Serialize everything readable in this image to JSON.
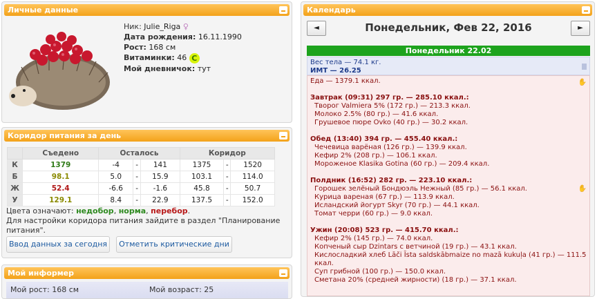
{
  "personal": {
    "title": "Личные данные",
    "nick_label": "Ник:",
    "nick": "Julie_Riga",
    "birth_label": "Дата рождения:",
    "birth": "16.11.1990",
    "height_label": "Рост:",
    "height": "168 см",
    "vit_label": "Витаминки:",
    "vit": "46",
    "vit_badge": "C",
    "diary_label": "Мой дневничок:",
    "diary": "тут"
  },
  "corridor": {
    "title": "Коридор питания за день",
    "headers": [
      "Съедено",
      "Осталось",
      "Коридор"
    ],
    "rows": [
      {
        "l": "К",
        "eat": "1379",
        "r1": "-4",
        "r2": "141",
        "c1": "1375",
        "c2": "1520"
      },
      {
        "l": "Б",
        "eat": "98.1",
        "r1": "5.0",
        "r2": "15.9",
        "c1": "103.1",
        "c2": "114.0"
      },
      {
        "l": "Ж",
        "eat": "52.4",
        "r1": "-6.6",
        "r2": "-1.6",
        "c1": "45.8",
        "c2": "50.7"
      },
      {
        "l": "У",
        "eat": "129.1",
        "r1": "8.4",
        "r2": "22.9",
        "c1": "137.5",
        "c2": "152.0"
      }
    ],
    "dash": "-",
    "legend_prefix": "Цвета означают:",
    "legend_under": "недобор",
    "legend_norm": "норма",
    "legend_over": "перебор",
    "legend_line2": "Для настройки коридора питания зайдите в раздел \"Планирование питания\".",
    "btn_enter": "Ввод данных за сегодня",
    "btn_crit": "Отметить критические дни"
  },
  "informer": {
    "title": "Мой информер",
    "height": "Мой рост: 168 см",
    "age": "Мой возраст: 25"
  },
  "calendar": {
    "title": "Календарь",
    "prev": "◄",
    "next": "►",
    "date": "Понедельник, Фев 22, 2016",
    "day": "Понедельник 22.02",
    "weight": "Вес тела — 74.1 кг.",
    "bmi": "ИМТ — 26.25",
    "food": "Еда — 1379.1 ккал.",
    "meals": [
      {
        "h": "Завтрак (09:31) 297 гр. — 285.10 ккал.:",
        "items": [
          "Творог Valmiera 5% (172 гр.) — 213.3 ккал.",
          "Молоко 2.5% (80 гр.) — 41.6 ккал.",
          "Грушевое пюре Ovko (40 гр.) — 30.2 ккал."
        ]
      },
      {
        "h": "Обед (13:40) 394 гр. — 455.40 ккал.:",
        "items": [
          "Чечевица варёная (126 гр.) — 139.9 ккал.",
          "Кефир 2% (208 гр.) — 106.1 ккал.",
          "Мороженое Klasika Gotina (60 гр.) — 209.4 ккал."
        ]
      },
      {
        "h": "Полдник (16:52) 282 гр. — 223.10 ккал.:",
        "items": [
          "Горошек зелёный Бондюэль Нежный (85 гр.) — 56.1 ккал.",
          "Курица вареная (67 гр.) — 113.9 ккал.",
          "Исландский йогурт Skyr (70 гр.) — 44.1 ккал.",
          "Томат черри (60 гр.) — 9.0 ккал."
        ]
      },
      {
        "h": "Ужин (20:08) 523 гр. — 415.70 ккал.:",
        "items": [
          "Кефир 2% (145 гр.) — 74.0 ккал.",
          "Копченый сыр Dzintars с ветчиной (19 гр.) — 43.1 ккал.",
          "Кислосладкий хлеб Lāči Īsta saldskābmaize no mazā kukuļa (41 гр.) — 111.5 ккал.",
          "Суп грибной (100 гр.) — 150.0 ккал.",
          "Сметана 20% (средней жирности) (18 гр.) — 37.1 ккал."
        ]
      }
    ]
  }
}
